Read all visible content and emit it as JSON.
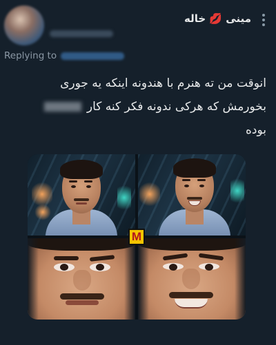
{
  "author": {
    "display_name": "مینی 💋 خاله"
  },
  "reply": {
    "label": "Replying to"
  },
  "tweet": {
    "line1": "انوقت من ته هنرم با هندونه اینکه یه جوری",
    "line2a": "بخورمش که هرکی ندونه فکر کنه کار",
    "line3": "بوده"
  },
  "media": {
    "logo_letter": "M"
  },
  "icons": {
    "more": "more-vertical-icon",
    "lips": "kiss-lips-icon"
  },
  "colors": {
    "background": "#15202b",
    "text": "#e7e9ea",
    "secondary": "#8b98a5",
    "logo_bg": "#f5c400",
    "logo_fg": "#b2141e"
  }
}
